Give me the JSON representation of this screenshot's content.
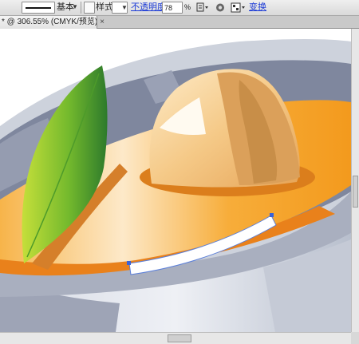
{
  "control_bar": {
    "stroke_profile_label": "基本",
    "style_label": "样式:",
    "opacity_label": "不透明度:",
    "opacity_value": "78",
    "opacity_unit": "%",
    "transform_label": "变换"
  },
  "document_tab": {
    "title": "* @ 306.55% (CMYK/预览)",
    "close_glyph": "×"
  },
  "colors": {
    "bowl_rim": "#cfd4dd",
    "bowl_inner": "#7e869f",
    "soup": "#f29a1f",
    "leaf": "#6cb52f",
    "mushroom": "#f3c98a"
  }
}
